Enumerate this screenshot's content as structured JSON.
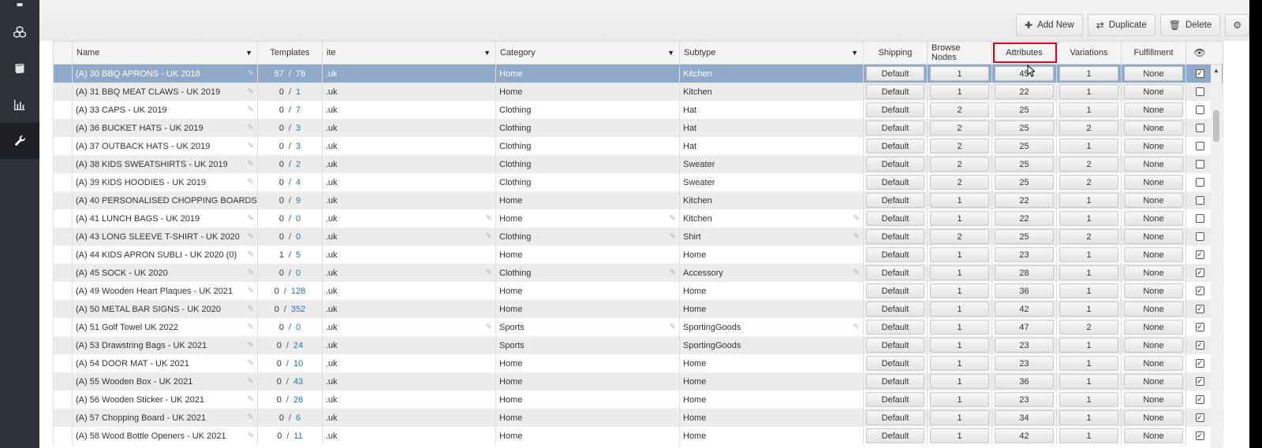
{
  "sidebar": {
    "items": [
      {
        "icon": "truck-icon"
      },
      {
        "icon": "cubes-icon"
      },
      {
        "icon": "book-icon"
      },
      {
        "icon": "bar-chart-icon"
      },
      {
        "icon": "wrench-icon"
      }
    ]
  },
  "toolbar": {
    "add_new": "Add New",
    "duplicate": "Duplicate",
    "delete": "Delete"
  },
  "columns": {
    "name": "Name",
    "templates": "Templates",
    "site": "ite",
    "category": "Category",
    "subtype": "Subtype",
    "shipping": "Shipping",
    "browse_nodes": "Browse Nodes",
    "attributes": "Attributes",
    "variations": "Variations",
    "fulfillment": "Fulfillment"
  },
  "rows": [
    {
      "name": "(A) 30 BBQ APRONS - UK 2018",
      "tmpl_a": "57",
      "tmpl_b": "78",
      "site": ".uk",
      "category": "Home",
      "subtype": "Kitchen",
      "shipping": "Default",
      "browse": "1",
      "attributes": "45",
      "variations": "1",
      "fulfillment": "None",
      "checked": true,
      "selected": true,
      "edit_cat": false,
      "edit_sub": false,
      "edit_subtype": false
    },
    {
      "name": "(A) 31 BBQ MEAT CLAWS - UK 2019",
      "tmpl_a": "0",
      "tmpl_b": "1",
      "site": ".uk",
      "category": "Home",
      "subtype": "Kitchen",
      "shipping": "Default",
      "browse": "1",
      "attributes": "22",
      "variations": "1",
      "fulfillment": "None",
      "checked": false
    },
    {
      "name": "(A) 33 CAPS - UK 2019",
      "tmpl_a": "0",
      "tmpl_b": "7",
      "site": ".uk",
      "category": "Clothing",
      "subtype": "Hat",
      "shipping": "Default",
      "browse": "2",
      "attributes": "25",
      "variations": "1",
      "fulfillment": "None",
      "checked": false
    },
    {
      "name": "(A) 36 BUCKET HATS - UK 2019",
      "tmpl_a": "0",
      "tmpl_b": "3",
      "site": ".uk",
      "category": "Clothing",
      "subtype": "Hat",
      "shipping": "Default",
      "browse": "2",
      "attributes": "25",
      "variations": "2",
      "fulfillment": "None",
      "checked": false
    },
    {
      "name": "(A) 37 OUTBACK HATS - UK 2019",
      "tmpl_a": "0",
      "tmpl_b": "3",
      "site": ".uk",
      "category": "Clothing",
      "subtype": "Hat",
      "shipping": "Default",
      "browse": "2",
      "attributes": "25",
      "variations": "1",
      "fulfillment": "None",
      "checked": false
    },
    {
      "name": "(A) 38 KIDS SWEATSHIRTS - UK 2019",
      "tmpl_a": "0",
      "tmpl_b": "2",
      "site": ".uk",
      "category": "Clothing",
      "subtype": "Sweater",
      "shipping": "Default",
      "browse": "2",
      "attributes": "25",
      "variations": "2",
      "fulfillment": "None",
      "checked": false
    },
    {
      "name": "(A) 39 KIDS HOODIES - UK 2019",
      "tmpl_a": "0",
      "tmpl_b": "4",
      "site": ".uk",
      "category": "Clothing",
      "subtype": "Sweater",
      "shipping": "Default",
      "browse": "2",
      "attributes": "25",
      "variations": "2",
      "fulfillment": "None",
      "checked": false
    },
    {
      "name": "(A) 40 PERSONALISED CHOPPING BOARDS",
      "tmpl_a": "0",
      "tmpl_b": "9",
      "site": ".uk",
      "category": "Home",
      "subtype": "Kitchen",
      "shipping": "Default",
      "browse": "1",
      "attributes": "22",
      "variations": "1",
      "fulfillment": "None",
      "checked": false
    },
    {
      "name": "(A) 41 LUNCH BAGS - UK 2019",
      "tmpl_a": "0",
      "tmpl_b": "0",
      "site": ".uk",
      "category": "Home",
      "subtype": "Kitchen",
      "shipping": "Default",
      "browse": "1",
      "attributes": "22",
      "variations": "1",
      "fulfillment": "None",
      "checked": false,
      "edit_site": true,
      "edit_cat": true,
      "edit_sub": true
    },
    {
      "name": "(A) 43 LONG SLEEVE T-SHIRT - UK 2020",
      "tmpl_a": "0",
      "tmpl_b": "0",
      "site": ".uk",
      "category": "Clothing",
      "subtype": "Shirt",
      "shipping": "Default",
      "browse": "2",
      "attributes": "25",
      "variations": "2",
      "fulfillment": "None",
      "checked": false,
      "edit_site": true,
      "edit_cat": true,
      "edit_sub": true
    },
    {
      "name": "(A) 44 KIDS APRON SUBLI - UK 2020 (0)",
      "tmpl_a": "1",
      "tmpl_b": "5",
      "site": ".uk",
      "category": "Home",
      "subtype": "Home",
      "shipping": "Default",
      "browse": "1",
      "attributes": "23",
      "variations": "1",
      "fulfillment": "None",
      "checked": true
    },
    {
      "name": "(A) 45 SOCK - UK 2020",
      "tmpl_a": "0",
      "tmpl_b": "0",
      "site": ".uk",
      "category": "Clothing",
      "subtype": "Accessory",
      "shipping": "Default",
      "browse": "1",
      "attributes": "28",
      "variations": "1",
      "fulfillment": "None",
      "checked": true,
      "edit_site": true,
      "edit_cat": true,
      "edit_sub": true
    },
    {
      "name": "(A) 49 Wooden Heart Plaques - UK 2021",
      "tmpl_a": "0",
      "tmpl_b": "128",
      "site": ".uk",
      "category": "Home",
      "subtype": "Home",
      "shipping": "Default",
      "browse": "1",
      "attributes": "36",
      "variations": "1",
      "fulfillment": "None",
      "checked": true
    },
    {
      "name": "(A) 50 METAL BAR SIGNS - UK 2020",
      "tmpl_a": "0",
      "tmpl_b": "352",
      "site": ".uk",
      "category": "Home",
      "subtype": "Home",
      "shipping": "Default",
      "browse": "1",
      "attributes": "42",
      "variations": "1",
      "fulfillment": "None",
      "checked": true
    },
    {
      "name": "(A) 51 Golf Towel UK 2022",
      "tmpl_a": "0",
      "tmpl_b": "0",
      "site": ".uk",
      "category": "Sports",
      "subtype": "SportingGoods",
      "shipping": "Default",
      "browse": "1",
      "attributes": "47",
      "variations": "2",
      "fulfillment": "None",
      "checked": true,
      "edit_site": true,
      "edit_cat": true,
      "edit_sub": true
    },
    {
      "name": "(A) 53 Drawstring Bags - UK 2021",
      "tmpl_a": "0",
      "tmpl_b": "24",
      "site": ".uk",
      "category": "Sports",
      "subtype": "SportingGoods",
      "shipping": "Default",
      "browse": "1",
      "attributes": "23",
      "variations": "1",
      "fulfillment": "None",
      "checked": true
    },
    {
      "name": "(A) 54 DOOR MAT - UK 2021",
      "tmpl_a": "0",
      "tmpl_b": "10",
      "site": ".uk",
      "category": "Home",
      "subtype": "Home",
      "shipping": "Default",
      "browse": "1",
      "attributes": "23",
      "variations": "1",
      "fulfillment": "None",
      "checked": true
    },
    {
      "name": "(A) 55 Wooden Box - UK 2021",
      "tmpl_a": "0",
      "tmpl_b": "43",
      "site": ".uk",
      "category": "Home",
      "subtype": "Home",
      "shipping": "Default",
      "browse": "1",
      "attributes": "36",
      "variations": "1",
      "fulfillment": "None",
      "checked": true
    },
    {
      "name": "(A) 56 Wooden Sticker - UK 2021",
      "tmpl_a": "0",
      "tmpl_b": "26",
      "site": ".uk",
      "category": "Home",
      "subtype": "Home",
      "shipping": "Default",
      "browse": "1",
      "attributes": "23",
      "variations": "1",
      "fulfillment": "None",
      "checked": true
    },
    {
      "name": "(A) 57 Chopping Board - UK 2021",
      "tmpl_a": "0",
      "tmpl_b": "6",
      "site": ".uk",
      "category": "Home",
      "subtype": "Home",
      "shipping": "Default",
      "browse": "1",
      "attributes": "34",
      "variations": "1",
      "fulfillment": "None",
      "checked": true
    },
    {
      "name": "(A) 58 Wood Bottle Openers - UK 2021",
      "tmpl_a": "0",
      "tmpl_b": "11",
      "site": ".uk",
      "category": "Home",
      "subtype": "Home",
      "shipping": "Default",
      "browse": "1",
      "attributes": "42",
      "variations": "1",
      "fulfillment": "None",
      "checked": true
    }
  ],
  "colors": {
    "selected_row": "#8fa9c8",
    "highlight_box": "#e8000b",
    "link_blue": "#1e74b8",
    "sidebar": "#2d3238"
  }
}
